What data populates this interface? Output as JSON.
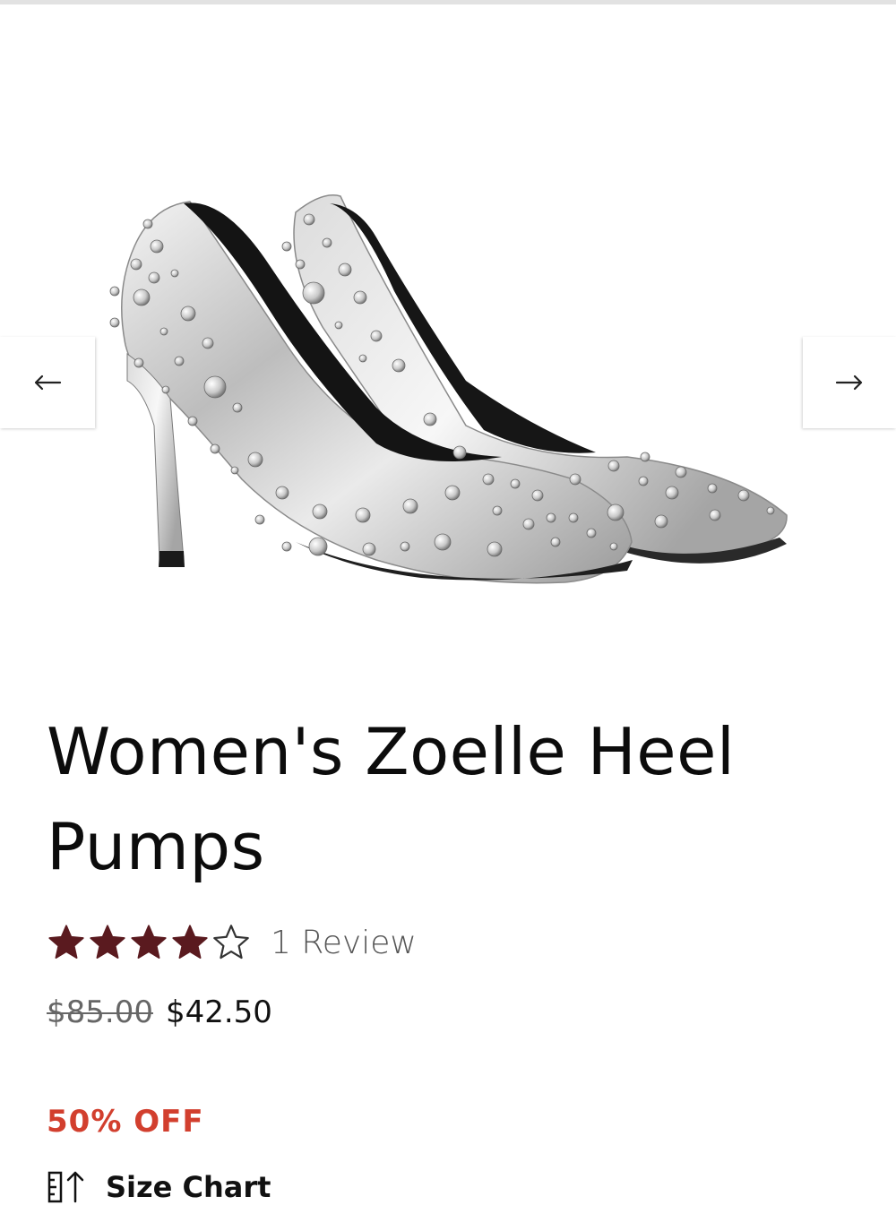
{
  "product": {
    "title": "Women's Zoelle Heel Pumps",
    "rating_value": 4,
    "rating_max": 5,
    "review_label": "1 Review",
    "price_original": "$85.00",
    "price_sale": "$42.50",
    "discount_label": "50% OFF",
    "size_chart_label": "Size Chart"
  },
  "gallery": {
    "prev_icon": "arrow-left-icon",
    "next_icon": "arrow-right-icon"
  },
  "colors": {
    "star": "#5a1a1f",
    "discount": "#d23f2e",
    "text": "#0c0c0c"
  }
}
